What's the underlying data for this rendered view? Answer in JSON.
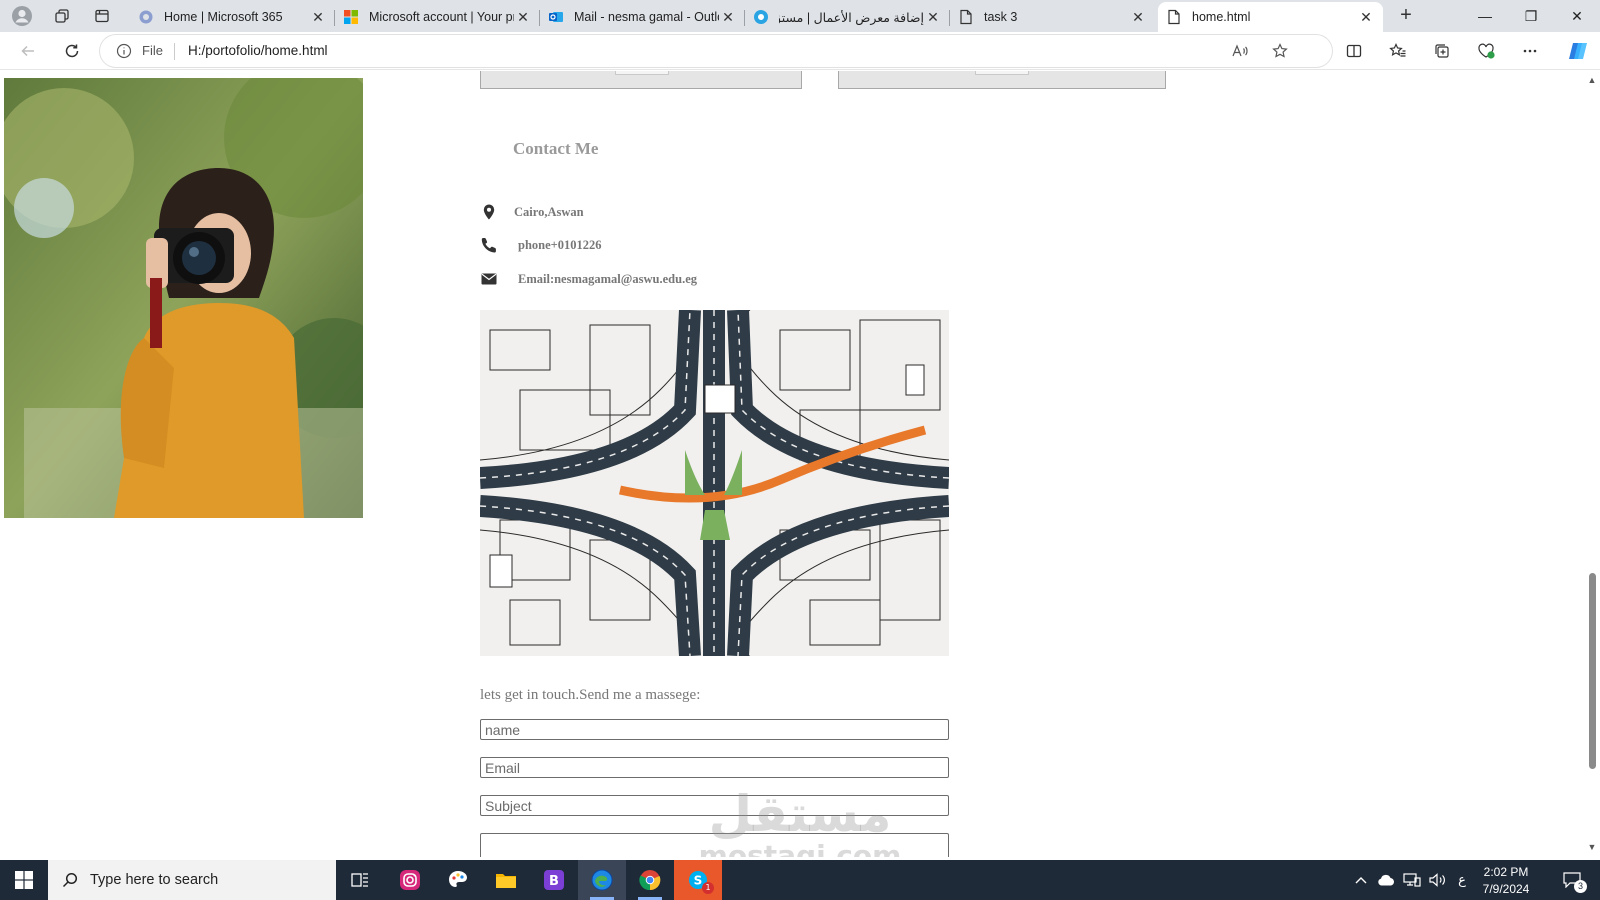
{
  "browser": {
    "tabs": [
      {
        "title": "Home | Microsoft 365",
        "favicon": "microsoft-365-icon"
      },
      {
        "title": "Microsoft account | Your pr",
        "favicon": "microsoft-logo-icon"
      },
      {
        "title": "Mail - nesma gamal - Outlo",
        "favicon": "outlook-icon"
      },
      {
        "title": "إضافة معرض الأعمال | مستق",
        "favicon": "mostaql-icon"
      },
      {
        "title": "task 3",
        "favicon": "document-icon"
      },
      {
        "title": "home.html",
        "favicon": "document-icon"
      }
    ],
    "active_tab_index": 5,
    "address": {
      "scheme_label": "File",
      "url": "H:/portofolio/home.html"
    },
    "colors": {
      "tab_strip": "#dfe3e8",
      "active_tab": "#ffffff",
      "accent": "#0a64c8"
    }
  },
  "page": {
    "contact": {
      "heading": "Contact Me",
      "location": "Cairo,Aswan",
      "phone": "phone+0101226",
      "email": "Email:nesmagamal@aswu.edu.eg"
    },
    "message_prompt": "lets get in touch.Send me a massege:",
    "form": {
      "name_placeholder": "name",
      "email_placeholder": "Email",
      "subject_placeholder": "Subject"
    },
    "watermark": {
      "arabic": "مستقل",
      "latin": "mostaqi.com"
    }
  },
  "taskbar": {
    "search_placeholder": "Type here to search",
    "language": "ع",
    "time": "2:02 PM",
    "date": "7/9/2024",
    "notification_count": "3",
    "skype_badge": "1"
  }
}
